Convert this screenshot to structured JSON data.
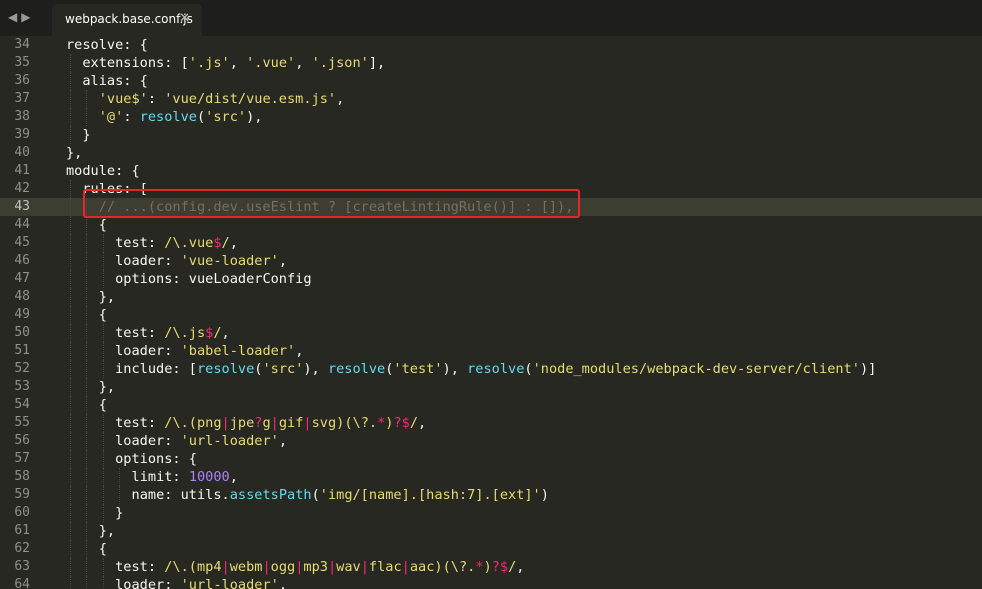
{
  "tabbar": {
    "nav_back": "◀",
    "nav_forward": "▶",
    "tab_title": "webpack.base.conf.js",
    "tab_close": "✕"
  },
  "editor": {
    "active_line": "43",
    "lines": [
      {
        "num": "34",
        "indent": 0,
        "tokens": [
          {
            "t": "resolve: {",
            "c": ""
          }
        ]
      },
      {
        "num": "35",
        "indent": 1,
        "tokens": [
          {
            "t": "extensions: [",
            "c": ""
          },
          {
            "t": "'.js'",
            "c": "s"
          },
          {
            "t": ", ",
            "c": ""
          },
          {
            "t": "'.vue'",
            "c": "s"
          },
          {
            "t": ", ",
            "c": ""
          },
          {
            "t": "'.json'",
            "c": "s"
          },
          {
            "t": "],",
            "c": ""
          }
        ]
      },
      {
        "num": "36",
        "indent": 1,
        "tokens": [
          {
            "t": "alias: {",
            "c": ""
          }
        ]
      },
      {
        "num": "37",
        "indent": 2,
        "tokens": [
          {
            "t": "'vue$'",
            "c": "s"
          },
          {
            "t": ": ",
            "c": ""
          },
          {
            "t": "'vue/dist/vue.esm.js'",
            "c": "s"
          },
          {
            "t": ",",
            "c": ""
          }
        ]
      },
      {
        "num": "38",
        "indent": 2,
        "tokens": [
          {
            "t": "'@'",
            "c": "s"
          },
          {
            "t": ": ",
            "c": ""
          },
          {
            "t": "resolve",
            "c": "f"
          },
          {
            "t": "(",
            "c": ""
          },
          {
            "t": "'src'",
            "c": "s"
          },
          {
            "t": "),",
            "c": ""
          }
        ]
      },
      {
        "num": "39",
        "indent": 1,
        "tokens": [
          {
            "t": "}",
            "c": ""
          }
        ]
      },
      {
        "num": "40",
        "indent": 0,
        "tokens": [
          {
            "t": "},",
            "c": ""
          }
        ]
      },
      {
        "num": "41",
        "indent": 0,
        "tokens": [
          {
            "t": "module: {",
            "c": ""
          }
        ]
      },
      {
        "num": "42",
        "indent": 1,
        "tokens": [
          {
            "t": "rules: [",
            "c": ""
          }
        ]
      },
      {
        "num": "43",
        "indent": 2,
        "tokens": [
          {
            "t": "// ...(config.dev.useEslint ? [createLintingRule()] : []),",
            "c": "c"
          }
        ]
      },
      {
        "num": "44",
        "indent": 2,
        "tokens": [
          {
            "t": "{",
            "c": ""
          }
        ]
      },
      {
        "num": "45",
        "indent": 3,
        "tokens": [
          {
            "t": "test: ",
            "c": ""
          },
          {
            "t": "/\\.vue",
            "c": "s"
          },
          {
            "t": "$",
            "c": "k"
          },
          {
            "t": "/",
            "c": "s"
          },
          {
            "t": ",",
            "c": ""
          }
        ]
      },
      {
        "num": "46",
        "indent": 3,
        "tokens": [
          {
            "t": "loader: ",
            "c": ""
          },
          {
            "t": "'vue-loader'",
            "c": "s"
          },
          {
            "t": ",",
            "c": ""
          }
        ]
      },
      {
        "num": "47",
        "indent": 3,
        "tokens": [
          {
            "t": "options: vueLoaderConfig",
            "c": ""
          }
        ]
      },
      {
        "num": "48",
        "indent": 2,
        "tokens": [
          {
            "t": "},",
            "c": ""
          }
        ]
      },
      {
        "num": "49",
        "indent": 2,
        "tokens": [
          {
            "t": "{",
            "c": ""
          }
        ]
      },
      {
        "num": "50",
        "indent": 3,
        "tokens": [
          {
            "t": "test: ",
            "c": ""
          },
          {
            "t": "/\\.js",
            "c": "s"
          },
          {
            "t": "$",
            "c": "k"
          },
          {
            "t": "/",
            "c": "s"
          },
          {
            "t": ",",
            "c": ""
          }
        ]
      },
      {
        "num": "51",
        "indent": 3,
        "tokens": [
          {
            "t": "loader: ",
            "c": ""
          },
          {
            "t": "'babel-loader'",
            "c": "s"
          },
          {
            "t": ",",
            "c": ""
          }
        ]
      },
      {
        "num": "52",
        "indent": 3,
        "tokens": [
          {
            "t": "include: [",
            "c": ""
          },
          {
            "t": "resolve",
            "c": "f"
          },
          {
            "t": "(",
            "c": ""
          },
          {
            "t": "'src'",
            "c": "s"
          },
          {
            "t": "), ",
            "c": ""
          },
          {
            "t": "resolve",
            "c": "f"
          },
          {
            "t": "(",
            "c": ""
          },
          {
            "t": "'test'",
            "c": "s"
          },
          {
            "t": "), ",
            "c": ""
          },
          {
            "t": "resolve",
            "c": "f"
          },
          {
            "t": "(",
            "c": ""
          },
          {
            "t": "'node_modules/webpack-dev-server/client'",
            "c": "s"
          },
          {
            "t": ")]",
            "c": ""
          }
        ]
      },
      {
        "num": "53",
        "indent": 2,
        "tokens": [
          {
            "t": "},",
            "c": ""
          }
        ]
      },
      {
        "num": "54",
        "indent": 2,
        "tokens": [
          {
            "t": "{",
            "c": ""
          }
        ]
      },
      {
        "num": "55",
        "indent": 3,
        "tokens": [
          {
            "t": "test: ",
            "c": ""
          },
          {
            "t": "/\\.(png",
            "c": "s"
          },
          {
            "t": "|",
            "c": "k"
          },
          {
            "t": "jpe",
            "c": "s"
          },
          {
            "t": "?",
            "c": "k"
          },
          {
            "t": "g",
            "c": "s"
          },
          {
            "t": "|",
            "c": "k"
          },
          {
            "t": "gif",
            "c": "s"
          },
          {
            "t": "|",
            "c": "k"
          },
          {
            "t": "svg)(\\?.",
            "c": "s"
          },
          {
            "t": "*",
            "c": "k"
          },
          {
            "t": ")",
            "c": "s"
          },
          {
            "t": "?$",
            "c": "k"
          },
          {
            "t": "/",
            "c": "s"
          },
          {
            "t": ",",
            "c": ""
          }
        ]
      },
      {
        "num": "56",
        "indent": 3,
        "tokens": [
          {
            "t": "loader: ",
            "c": ""
          },
          {
            "t": "'url-loader'",
            "c": "s"
          },
          {
            "t": ",",
            "c": ""
          }
        ]
      },
      {
        "num": "57",
        "indent": 3,
        "tokens": [
          {
            "t": "options: {",
            "c": ""
          }
        ]
      },
      {
        "num": "58",
        "indent": 4,
        "tokens": [
          {
            "t": "limit: ",
            "c": ""
          },
          {
            "t": "10000",
            "c": "n"
          },
          {
            "t": ",",
            "c": ""
          }
        ]
      },
      {
        "num": "59",
        "indent": 4,
        "tokens": [
          {
            "t": "name: utils.",
            "c": ""
          },
          {
            "t": "assetsPath",
            "c": "f"
          },
          {
            "t": "(",
            "c": ""
          },
          {
            "t": "'img/[name].[hash:7].[ext]'",
            "c": "s"
          },
          {
            "t": ")",
            "c": ""
          }
        ]
      },
      {
        "num": "60",
        "indent": 3,
        "tokens": [
          {
            "t": "}",
            "c": ""
          }
        ]
      },
      {
        "num": "61",
        "indent": 2,
        "tokens": [
          {
            "t": "},",
            "c": ""
          }
        ]
      },
      {
        "num": "62",
        "indent": 2,
        "tokens": [
          {
            "t": "{",
            "c": ""
          }
        ]
      },
      {
        "num": "63",
        "indent": 3,
        "tokens": [
          {
            "t": "test: ",
            "c": ""
          },
          {
            "t": "/\\.(mp4",
            "c": "s"
          },
          {
            "t": "|",
            "c": "k"
          },
          {
            "t": "webm",
            "c": "s"
          },
          {
            "t": "|",
            "c": "k"
          },
          {
            "t": "ogg",
            "c": "s"
          },
          {
            "t": "|",
            "c": "k"
          },
          {
            "t": "mp3",
            "c": "s"
          },
          {
            "t": "|",
            "c": "k"
          },
          {
            "t": "wav",
            "c": "s"
          },
          {
            "t": "|",
            "c": "k"
          },
          {
            "t": "flac",
            "c": "s"
          },
          {
            "t": "|",
            "c": "k"
          },
          {
            "t": "aac)(\\?.",
            "c": "s"
          },
          {
            "t": "*",
            "c": "k"
          },
          {
            "t": ")",
            "c": "s"
          },
          {
            "t": "?$",
            "c": "k"
          },
          {
            "t": "/",
            "c": "s"
          },
          {
            "t": ",",
            "c": ""
          }
        ]
      },
      {
        "num": "64",
        "indent": 3,
        "tokens": [
          {
            "t": "loader: ",
            "c": ""
          },
          {
            "t": "'url-loader'",
            "c": "s"
          },
          {
            "t": ",",
            "c": ""
          }
        ]
      }
    ]
  },
  "colors": {
    "background": "#272822",
    "string": "#e6db74",
    "function": "#66d9ef",
    "number": "#ae81ff",
    "keyword": "#f92672",
    "comment": "#75715e",
    "highlight_box": "#e8262a"
  }
}
